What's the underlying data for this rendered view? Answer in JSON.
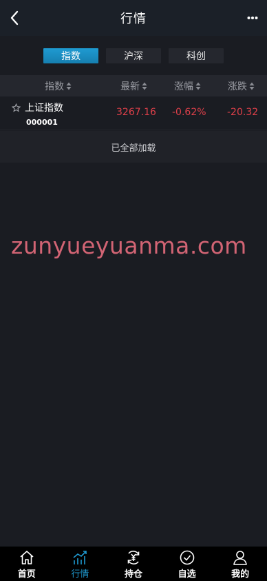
{
  "header": {
    "title": "行情",
    "back_icon": "chevron-left-icon",
    "more_icon": "ellipsis-icon"
  },
  "tabs": [
    {
      "label": "指数",
      "active": true
    },
    {
      "label": "沪深",
      "active": false
    },
    {
      "label": "科创",
      "active": false
    }
  ],
  "columns": {
    "name": "指数",
    "latest": "最新",
    "change_pct": "涨幅",
    "change": "涨跌"
  },
  "rows": [
    {
      "name": "上证指数",
      "code": "000001",
      "latest": "3267.16",
      "change_pct": "-0.62%",
      "change": "-20.32"
    }
  ],
  "status": {
    "loaded_text": "已全部加载"
  },
  "watermark": "zunyueyuanma.com",
  "bottom_nav": [
    {
      "label": "首页",
      "icon": "home-icon",
      "active": false
    },
    {
      "label": "行情",
      "icon": "chart-icon",
      "active": true
    },
    {
      "label": "持仓",
      "icon": "yen-refresh-icon",
      "active": false
    },
    {
      "label": "自选",
      "icon": "check-circle-icon",
      "active": false
    },
    {
      "label": "我的",
      "icon": "user-icon",
      "active": false
    }
  ],
  "colors": {
    "accent": "#1f9bd2",
    "down": "#e0404a",
    "background": "#1a1c22"
  }
}
